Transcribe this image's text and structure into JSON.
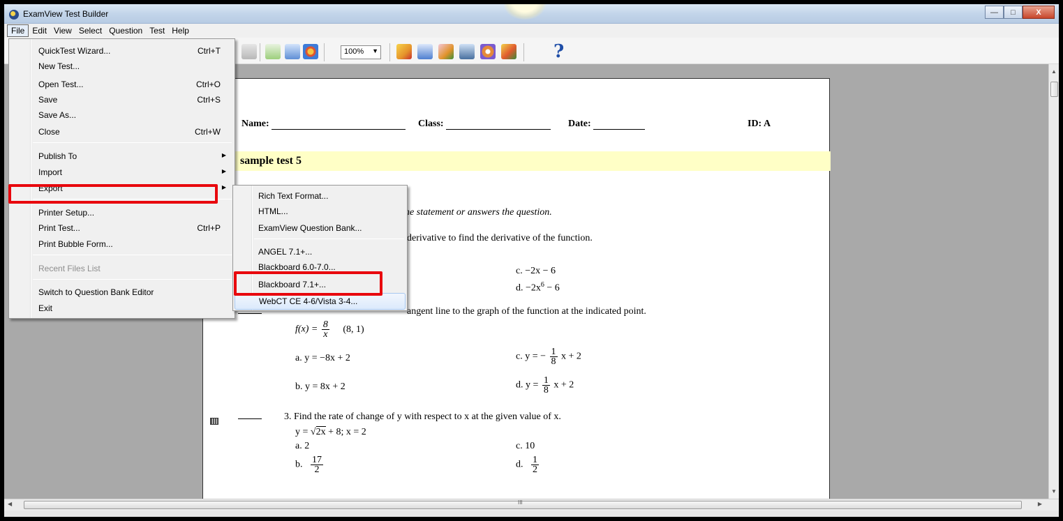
{
  "window": {
    "title": "ExamView Test Builder",
    "minimize": "—",
    "maximize": "□",
    "close": "X"
  },
  "menubar": [
    "File",
    "Edit",
    "View",
    "Select",
    "Question",
    "Test",
    "Help"
  ],
  "toolbar": {
    "zoom": "100%",
    "zoom_arrow": "▼",
    "help": "?"
  },
  "file_menu": [
    {
      "label": "QuickTest Wizard...",
      "shortcut": "Ctrl+T"
    },
    {
      "label": "New Test...",
      "shortcut": ""
    },
    {
      "label": "Open Test...",
      "shortcut": "Ctrl+O"
    },
    {
      "label": "Save",
      "shortcut": "Ctrl+S"
    },
    {
      "label": "Save As...",
      "shortcut": ""
    },
    {
      "label": "Close",
      "shortcut": "Ctrl+W"
    },
    {
      "label": "Publish To",
      "shortcut": ""
    },
    {
      "label": "Import",
      "shortcut": ""
    },
    {
      "label": "Export",
      "shortcut": ""
    },
    {
      "label": "Printer Setup...",
      "shortcut": ""
    },
    {
      "label": "Print Test...",
      "shortcut": "Ctrl+P"
    },
    {
      "label": "Print Bubble Form...",
      "shortcut": ""
    },
    {
      "label": "Recent Files List",
      "shortcut": ""
    },
    {
      "label": "Switch to Question Bank Editor",
      "shortcut": ""
    },
    {
      "label": "Exit",
      "shortcut": ""
    }
  ],
  "submenu_arrow": "▶",
  "export_menu": [
    "Rich Text Format...",
    "HTML...",
    "ExamView Question Bank...",
    "ANGEL 7.1+...",
    "Blackboard 6.0-7.0...",
    "Blackboard 7.1+...",
    "WebCT CE 4-6/Vista 3-4..."
  ],
  "document": {
    "name_label": "Name:",
    "class_label": "Class:",
    "date_label": "Date:",
    "id_label": "ID: A",
    "title": "sample test 5",
    "instructions_tail": "es the statement or answers the question.",
    "q1_tail": "derivative to find the derivative of the function.",
    "q1_c": "c.   −2x − 6",
    "q1_d_pre": "d.   −2x",
    "q1_d_exp": "6",
    "q1_d_post": " − 6",
    "q2_tail": "angent line to the graph of the function at the indicated point.",
    "q2_func_pre": "f(x) =",
    "q2_func_num": "8",
    "q2_func_den": "x",
    "q2_point": "(8, 1)",
    "q2_a": "a.   y = −8x + 2",
    "q2_b": "b.   y = 8x + 2",
    "q2_c_pre": "c.   y = −",
    "q2_c_num": "1",
    "q2_c_den": "8",
    "q2_c_post": "x + 2",
    "q2_d_pre": "d.   y =",
    "q2_d_num": "1",
    "q2_d_den": "8",
    "q2_d_post": "x + 2",
    "q3_stem": "3.  Find the rate of change of y with respect to x at the given value of x.",
    "q3_eq_pre": "y = √",
    "q3_eq_rad": "2x",
    "q3_eq_post": " + 8;   x = 2",
    "q3_a": "a.   2",
    "q3_b_pre": "b.",
    "q3_b_num": "17",
    "q3_b_den": "2",
    "q3_c": "c.   10",
    "q3_d_pre": "d.",
    "q3_d_num": "1",
    "q3_d_den": "2"
  },
  "scrollbar": {
    "up": "▲",
    "down": "▼",
    "left": "◀",
    "right": "▶",
    "grip": "III"
  }
}
